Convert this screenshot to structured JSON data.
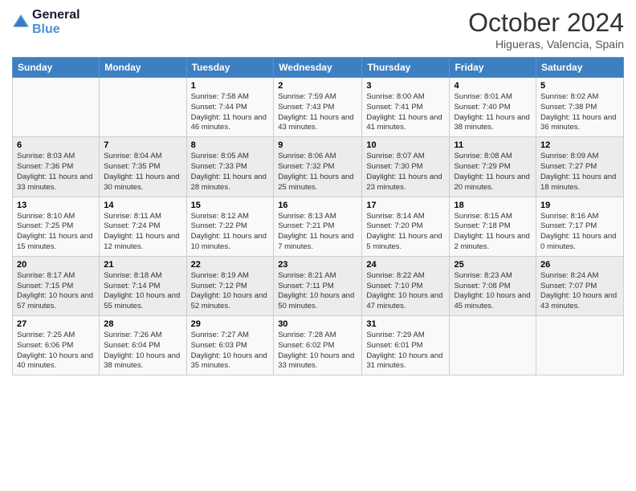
{
  "logo": {
    "line1": "General",
    "line2": "Blue"
  },
  "title": "October 2024",
  "location": "Higueras, Valencia, Spain",
  "days_header": [
    "Sunday",
    "Monday",
    "Tuesday",
    "Wednesday",
    "Thursday",
    "Friday",
    "Saturday"
  ],
  "weeks": [
    [
      {
        "num": "",
        "info": ""
      },
      {
        "num": "",
        "info": ""
      },
      {
        "num": "1",
        "info": "Sunrise: 7:58 AM\nSunset: 7:44 PM\nDaylight: 11 hours and 46 minutes."
      },
      {
        "num": "2",
        "info": "Sunrise: 7:59 AM\nSunset: 7:43 PM\nDaylight: 11 hours and 43 minutes."
      },
      {
        "num": "3",
        "info": "Sunrise: 8:00 AM\nSunset: 7:41 PM\nDaylight: 11 hours and 41 minutes."
      },
      {
        "num": "4",
        "info": "Sunrise: 8:01 AM\nSunset: 7:40 PM\nDaylight: 11 hours and 38 minutes."
      },
      {
        "num": "5",
        "info": "Sunrise: 8:02 AM\nSunset: 7:38 PM\nDaylight: 11 hours and 36 minutes."
      }
    ],
    [
      {
        "num": "6",
        "info": "Sunrise: 8:03 AM\nSunset: 7:36 PM\nDaylight: 11 hours and 33 minutes."
      },
      {
        "num": "7",
        "info": "Sunrise: 8:04 AM\nSunset: 7:35 PM\nDaylight: 11 hours and 30 minutes."
      },
      {
        "num": "8",
        "info": "Sunrise: 8:05 AM\nSunset: 7:33 PM\nDaylight: 11 hours and 28 minutes."
      },
      {
        "num": "9",
        "info": "Sunrise: 8:06 AM\nSunset: 7:32 PM\nDaylight: 11 hours and 25 minutes."
      },
      {
        "num": "10",
        "info": "Sunrise: 8:07 AM\nSunset: 7:30 PM\nDaylight: 11 hours and 23 minutes."
      },
      {
        "num": "11",
        "info": "Sunrise: 8:08 AM\nSunset: 7:29 PM\nDaylight: 11 hours and 20 minutes."
      },
      {
        "num": "12",
        "info": "Sunrise: 8:09 AM\nSunset: 7:27 PM\nDaylight: 11 hours and 18 minutes."
      }
    ],
    [
      {
        "num": "13",
        "info": "Sunrise: 8:10 AM\nSunset: 7:25 PM\nDaylight: 11 hours and 15 minutes."
      },
      {
        "num": "14",
        "info": "Sunrise: 8:11 AM\nSunset: 7:24 PM\nDaylight: 11 hours and 12 minutes."
      },
      {
        "num": "15",
        "info": "Sunrise: 8:12 AM\nSunset: 7:22 PM\nDaylight: 11 hours and 10 minutes."
      },
      {
        "num": "16",
        "info": "Sunrise: 8:13 AM\nSunset: 7:21 PM\nDaylight: 11 hours and 7 minutes."
      },
      {
        "num": "17",
        "info": "Sunrise: 8:14 AM\nSunset: 7:20 PM\nDaylight: 11 hours and 5 minutes."
      },
      {
        "num": "18",
        "info": "Sunrise: 8:15 AM\nSunset: 7:18 PM\nDaylight: 11 hours and 2 minutes."
      },
      {
        "num": "19",
        "info": "Sunrise: 8:16 AM\nSunset: 7:17 PM\nDaylight: 11 hours and 0 minutes."
      }
    ],
    [
      {
        "num": "20",
        "info": "Sunrise: 8:17 AM\nSunset: 7:15 PM\nDaylight: 10 hours and 57 minutes."
      },
      {
        "num": "21",
        "info": "Sunrise: 8:18 AM\nSunset: 7:14 PM\nDaylight: 10 hours and 55 minutes."
      },
      {
        "num": "22",
        "info": "Sunrise: 8:19 AM\nSunset: 7:12 PM\nDaylight: 10 hours and 52 minutes."
      },
      {
        "num": "23",
        "info": "Sunrise: 8:21 AM\nSunset: 7:11 PM\nDaylight: 10 hours and 50 minutes."
      },
      {
        "num": "24",
        "info": "Sunrise: 8:22 AM\nSunset: 7:10 PM\nDaylight: 10 hours and 47 minutes."
      },
      {
        "num": "25",
        "info": "Sunrise: 8:23 AM\nSunset: 7:08 PM\nDaylight: 10 hours and 45 minutes."
      },
      {
        "num": "26",
        "info": "Sunrise: 8:24 AM\nSunset: 7:07 PM\nDaylight: 10 hours and 43 minutes."
      }
    ],
    [
      {
        "num": "27",
        "info": "Sunrise: 7:25 AM\nSunset: 6:06 PM\nDaylight: 10 hours and 40 minutes."
      },
      {
        "num": "28",
        "info": "Sunrise: 7:26 AM\nSunset: 6:04 PM\nDaylight: 10 hours and 38 minutes."
      },
      {
        "num": "29",
        "info": "Sunrise: 7:27 AM\nSunset: 6:03 PM\nDaylight: 10 hours and 35 minutes."
      },
      {
        "num": "30",
        "info": "Sunrise: 7:28 AM\nSunset: 6:02 PM\nDaylight: 10 hours and 33 minutes."
      },
      {
        "num": "31",
        "info": "Sunrise: 7:29 AM\nSunset: 6:01 PM\nDaylight: 10 hours and 31 minutes."
      },
      {
        "num": "",
        "info": ""
      },
      {
        "num": "",
        "info": ""
      }
    ]
  ]
}
